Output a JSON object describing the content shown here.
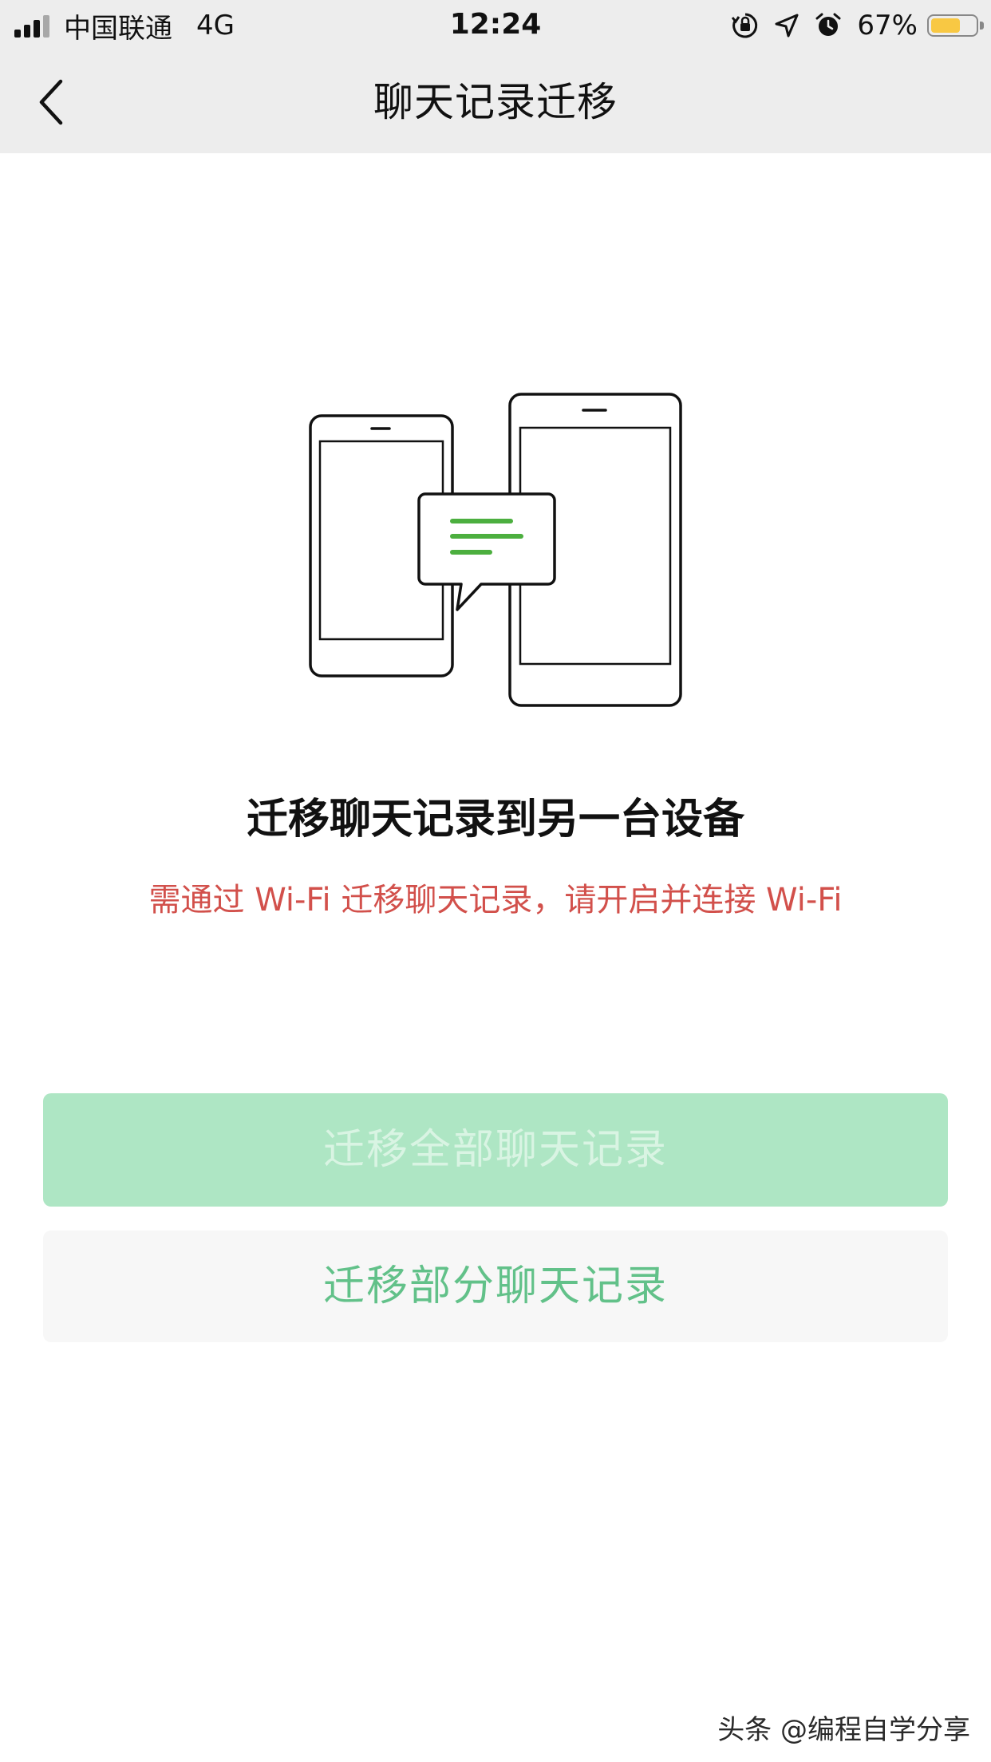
{
  "status_bar": {
    "carrier": "中国联通",
    "network": "4G",
    "time": "12:24",
    "battery_percent": "67%",
    "battery_level": 0.67,
    "battery_color": "#f8c843"
  },
  "nav": {
    "title": "聊天记录迁移",
    "back_icon": "chevron-left-icon"
  },
  "illustration": {
    "icon": "phone-to-tablet-chat-transfer-icon",
    "accent_color": "#4caf3f"
  },
  "content": {
    "headline": "迁移聊天记录到另一台设备",
    "warning": "需通过 Wi-Fi 迁移聊天记录，请开启并连接 Wi-Fi",
    "warning_color": "#d2504b"
  },
  "buttons": {
    "migrate_all": "迁移全部聊天记录",
    "migrate_partial": "迁移部分聊天记录",
    "primary_color": "#aee6c4",
    "secondary_text_color": "#62c189"
  },
  "watermark": {
    "text": "头条 @编程自学分享"
  }
}
